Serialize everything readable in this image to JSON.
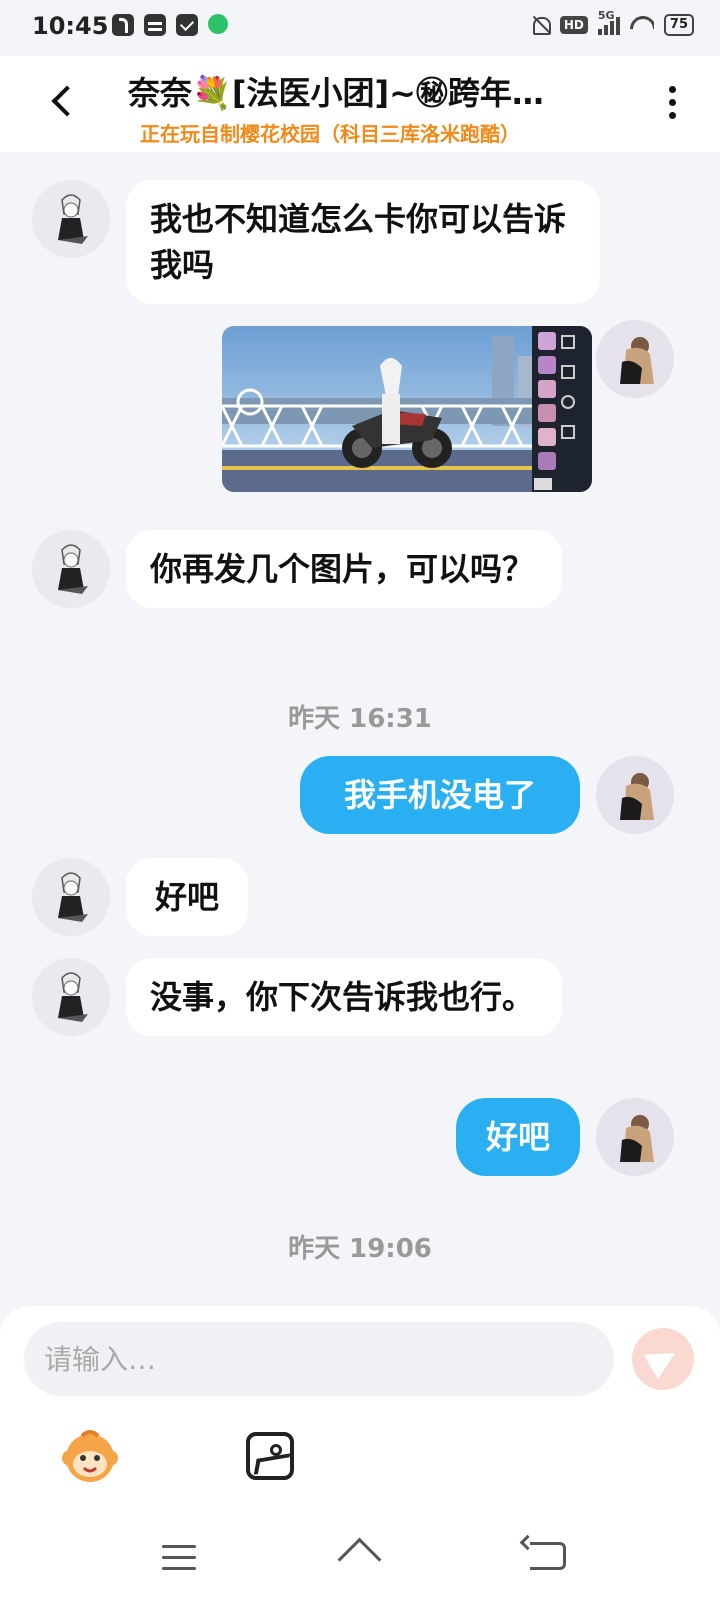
{
  "status_bar": {
    "time": "10:45",
    "network": "5G",
    "hd_label": "HD",
    "battery": "75"
  },
  "header": {
    "title": "奈奈💐[法医小团]~㊙跨年…",
    "subtitle": "正在玩自制樱花校园（科目三库洛米跑酷）"
  },
  "messages": [
    {
      "side": "in",
      "type": "text",
      "text": "我也不知道怎么卡你可以告诉我吗"
    },
    {
      "side": "out",
      "type": "image"
    },
    {
      "side": "in",
      "type": "text",
      "text": "你再发几个图片，可以吗？"
    },
    {
      "side": "time",
      "text": "昨天 16:31"
    },
    {
      "side": "out",
      "type": "text",
      "text": "我手机没电了"
    },
    {
      "side": "in",
      "type": "text",
      "text": "好吧"
    },
    {
      "side": "in",
      "type": "text",
      "text": "没事，你下次告诉我也行。"
    },
    {
      "side": "out",
      "type": "text",
      "text": "好吧"
    },
    {
      "side": "time",
      "text": "昨天 19:06"
    }
  ],
  "input": {
    "placeholder": "请输入…",
    "value": ""
  },
  "icons": {
    "emoji": "monkey-emoji-icon",
    "photo": "photo-icon",
    "send": "send-icon"
  },
  "colors": {
    "outgoing_bubble": "#2ab0f2",
    "incoming_bubble": "#ffffff",
    "subtitle": "#f08a1a",
    "background": "#f4f5f9"
  }
}
